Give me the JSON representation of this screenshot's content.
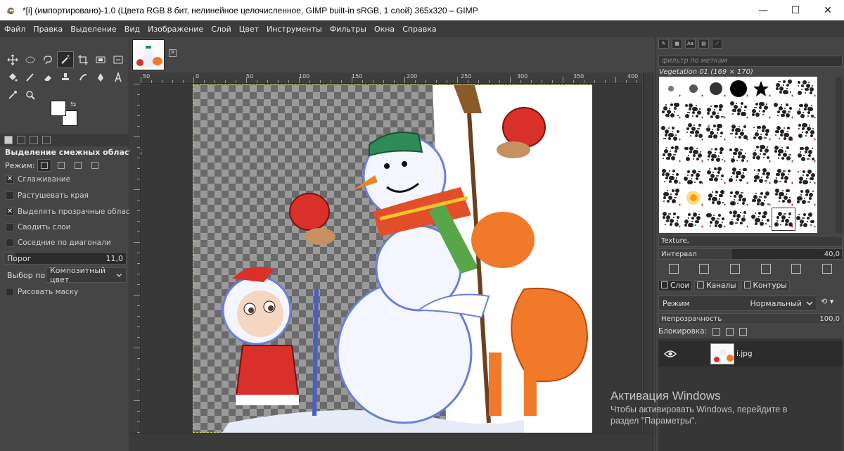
{
  "window": {
    "title": "*[i] (импортировано)-1.0 (Цвета RGB 8 бит, нелинейное целочисленное, GIMP built-in sRGB, 1 слой) 365x320 – GIMP",
    "minimize_glyph": "—",
    "maximize_glyph": "☐",
    "close_glyph": "✕"
  },
  "menu": [
    "Файл",
    "Правка",
    "Выделение",
    "Вид",
    "Изображение",
    "Слой",
    "Цвет",
    "Инструменты",
    "Фильтры",
    "Окна",
    "Справка"
  ],
  "toolbox": {
    "tools": [
      "move-tool",
      "ellipse-select-tool",
      "free-select-tool",
      "fuzzy-select-tool",
      "crop-tool",
      "warp-tool",
      "text-tool",
      "bucket-fill-tool",
      "paintbrush-tool",
      "eraser-tool",
      "clone-tool",
      "smudge-tool",
      "paths-tool",
      "text-a-tool",
      "color-picker-tool",
      "zoom-tool"
    ],
    "active_tool": "fuzzy-select-tool",
    "options_title": "Выделение смежных областей",
    "mode_label": "Режим:",
    "antialias_label": "Сглаживание",
    "feather_label": "Растушевать края",
    "transparent_label": "Выделять прозрачные области",
    "merge_label": "Сводить слои",
    "diagonal_label": "Соседние по диагонали",
    "threshold_label": "Порог",
    "threshold_value": "11,0",
    "threshold_fraction": 0.09,
    "select_by_label": "Выбор по",
    "select_by_value": "Композитный цвет",
    "draw_mask_label": "Рисовать маску",
    "antialias_checked": "✕",
    "transparent_checked": "✕"
  },
  "rulers": {
    "h_labels": [
      "50",
      "0",
      "50",
      "100",
      "150",
      "200",
      "250",
      "300",
      "350",
      "400"
    ]
  },
  "brushes": {
    "filter_placeholder": "фильтр по меткам",
    "selected_name": "Vegetation 01 (169 × 170)",
    "texture": "Texture,",
    "interval_label": "Интервал",
    "interval_value": "40,0",
    "interval_fraction": 0.4
  },
  "layers": {
    "tabs": [
      "Слои",
      "Каналы",
      "Контуры"
    ],
    "mode_label": "Режим",
    "mode_value": "Нормальный",
    "opacity_label": "Непрозрачность",
    "opacity_value": "100,0",
    "opacity_fraction": 1.0,
    "lock_label": "Блокировка:",
    "layer_name": "i.jpg"
  },
  "activation": {
    "title": "Активация Windows",
    "line1": "Чтобы активировать Windows, перейдите в",
    "line2": "раздел \"Параметры\"."
  },
  "colors": {
    "accent_selection": "#dede60",
    "canvas_bg": "#373737",
    "panel_bg": "#454545"
  }
}
